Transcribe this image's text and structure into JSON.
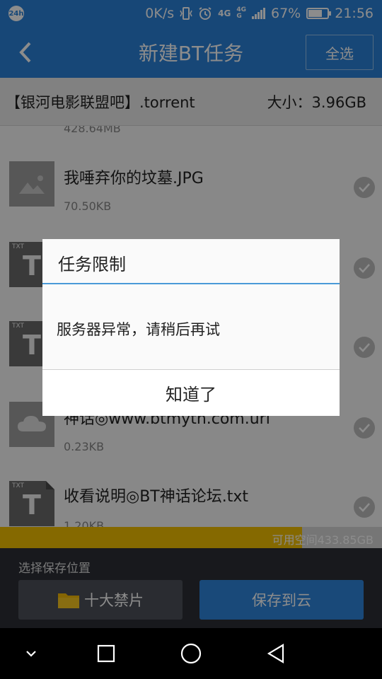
{
  "status_bar": {
    "badge": "24h",
    "speed": "0K/s",
    "network_1": "4G",
    "network_2_top": "4G",
    "network_2_bottom": "G",
    "battery_percent": "67%",
    "battery_level": 0.67,
    "time": "21:56"
  },
  "header": {
    "title": "新建BT任务",
    "select_all": "全选"
  },
  "torrent": {
    "name": "【银河电影联盟吧】.torrent",
    "size": "大小：3.96GB"
  },
  "files": [
    {
      "name": "",
      "size": "428.64MB",
      "icon": "video-icon"
    },
    {
      "name": "我唾弃你的坟墓.JPG",
      "size": "70.50KB",
      "icon": "image-icon"
    },
    {
      "name": "",
      "size": "",
      "icon": "txt-file-icon"
    },
    {
      "name": "",
      "size": "",
      "icon": "txt-file-icon"
    },
    {
      "name": "神话◎www.btmyth.com.url",
      "size": "0.23KB",
      "icon": "cloud-file-icon"
    },
    {
      "name": "收看说明◎BT神话论坛.txt",
      "size": "1.20KB",
      "icon": "txt-file-icon"
    }
  ],
  "storage": {
    "label": "可用空间433.85GB",
    "used_fraction": 0.79
  },
  "bottom": {
    "save_location_label": "选择保存位置",
    "folder_button": "十大禁片",
    "cloud_button": "保存到云"
  },
  "dialog": {
    "title": "任务限制",
    "message": "服务器异常，请稍后再试",
    "ok_button": "知道了"
  },
  "colors": {
    "accent": "#2b82d9",
    "dialog_divider": "#4a9ad8",
    "storage_fill": "#f3c000",
    "bottom_panel": "#2c2f36"
  },
  "thumb_tags": {
    "txt": "TXT",
    "txt_letter": "T"
  }
}
